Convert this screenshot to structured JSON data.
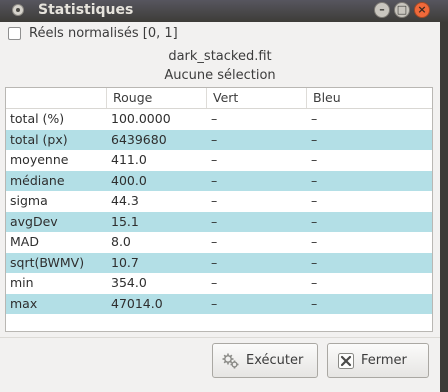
{
  "window": {
    "title": "Statistiques",
    "buttons": {
      "minimize": "–",
      "maximize": "□",
      "close": "×"
    }
  },
  "options": {
    "normalized_label": "Réels normalisés [0, 1]",
    "normalized_checked": false
  },
  "info": {
    "filename": "dark_stacked.fit",
    "selection": "Aucune sélection"
  },
  "table": {
    "headers": [
      "",
      "Rouge",
      "Vert",
      "Bleu"
    ],
    "rows": [
      {
        "name": "total (%)",
        "rouge": "100.0000",
        "vert": "–",
        "bleu": "–"
      },
      {
        "name": "total (px)",
        "rouge": "6439680",
        "vert": "–",
        "bleu": "–"
      },
      {
        "name": "moyenne",
        "rouge": "411.0",
        "vert": "–",
        "bleu": "–"
      },
      {
        "name": "médiane",
        "rouge": "400.0",
        "vert": "–",
        "bleu": "–"
      },
      {
        "name": "sigma",
        "rouge": "44.3",
        "vert": "–",
        "bleu": "–"
      },
      {
        "name": "avgDev",
        "rouge": "15.1",
        "vert": "–",
        "bleu": "–"
      },
      {
        "name": "MAD",
        "rouge": "8.0",
        "vert": "–",
        "bleu": "–"
      },
      {
        "name": "sqrt(BWMV)",
        "rouge": "10.7",
        "vert": "–",
        "bleu": "–"
      },
      {
        "name": "min",
        "rouge": "354.0",
        "vert": "–",
        "bleu": "–"
      },
      {
        "name": "max",
        "rouge": "47014.0",
        "vert": "–",
        "bleu": "–"
      }
    ]
  },
  "actions": {
    "execute_label": "Exécuter",
    "execute_icon": "gears-icon",
    "close_label": "Fermer",
    "close_icon": "x-icon"
  },
  "colors": {
    "alt_row": "#b3dfe6",
    "titlebar": "#3d3c38",
    "close_button": "#f0693a"
  }
}
